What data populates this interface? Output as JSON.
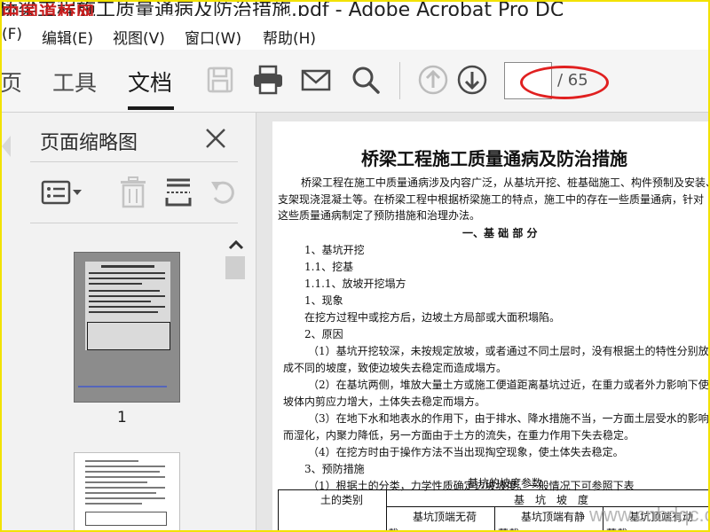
{
  "window": {
    "title_fragment": "桥梁工程施工质量通病及防治措施.pdf - Adobe Acrobat Pro DC",
    "watermark_logo": "中国道桥网"
  },
  "menu": {
    "file": "(F)",
    "edit": "编辑(E)",
    "view": "视图(V)",
    "window": "窗口(W)",
    "help": "帮助(H)"
  },
  "toolbar": {
    "tab_home": "页",
    "tab_tools": "工具",
    "tab_document": "文档",
    "page_current": "",
    "page_total": "/ 65"
  },
  "sidepanel": {
    "title": "页面缩略图",
    "thumb1_page": "1"
  },
  "document": {
    "title": "桥梁工程施工质量通病及防治措施",
    "lines": [
      "桥梁工程在施工中质量通病涉及内容广泛，从基坑开挖、桩基础施工、构件预制及安装、",
      "支架现浇混凝土等。在桥梁工程中根据桥梁施工的特点，施工中的存在一些质量通病，针对",
      "这些质量通病制定了预防措施和治理办法。",
      "一、基 础 部 分",
      "1、基坑开挖",
      "1.1、挖基",
      "1.1.1、放坡开挖塌方",
      "1、现象",
      "在挖方过程中或挖方后，边坡土方局部或大面积塌陷。",
      "2、原因",
      "（1）基坑开挖较深，未按规定放坡，或者通过不同土层时，没有根据土的特性分别放",
      "成不同的坡度，致使边坡失去稳定而造成塌方。",
      "（2）在基坑两侧，堆放大量土方或施工便道距离基坑过近，在重力或者外力影响下使",
      "坡体内剪应力增大，土体失去稳定而塌方。",
      "（3）在地下水和地表水的作用下，由于排水、降水措施不当，一方面土层受水的影响",
      "而湿化，内聚力降低，另一方面由于土方的流失，在重力作用下失去稳定。",
      "（4）在挖方时由于操作方法不当出现掏空现象，使土体失去稳定。",
      "3、预防措施",
      "（1）根据土的分类，力学性质确定边坡坡度。一般情况下可参照下表",
      "基坑的坡度参数"
    ],
    "table": {
      "col1_header": "土的类别",
      "group_header": "基　坑　坡　度",
      "sub1": "基坑顶端无荷",
      "sub2": "基坑顶端有静",
      "sub3": "基坑顶端有动",
      "row2a": "载",
      "row2b": "荷载",
      "row2c": "荷载"
    },
    "corner_watermark": "www.cnbdqc.com"
  }
}
